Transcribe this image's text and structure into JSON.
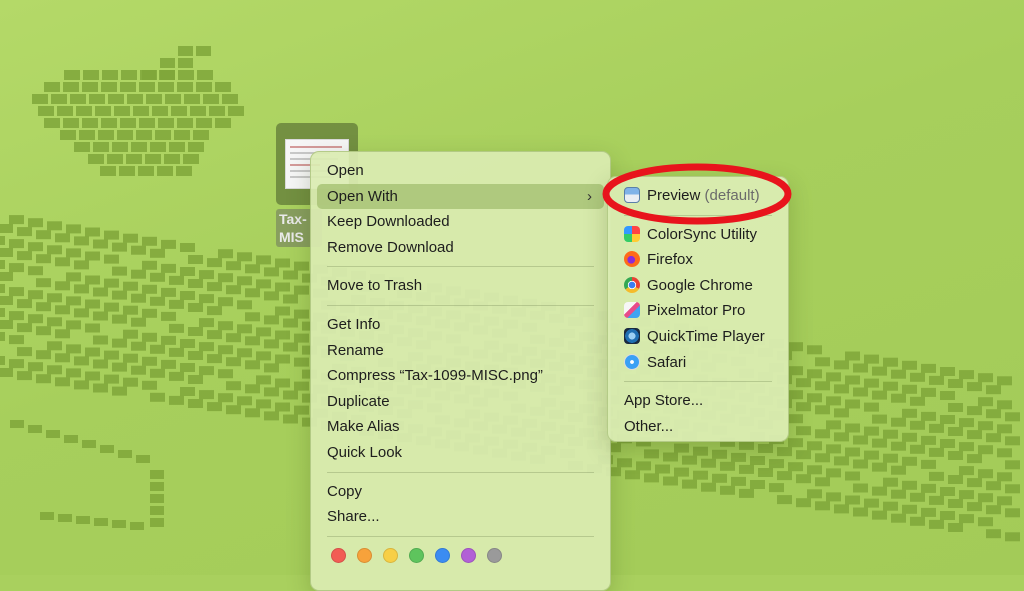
{
  "file": {
    "label_line1": "Tax-",
    "label_line2": "MIS"
  },
  "context_menu": {
    "items": [
      {
        "label": "Open"
      },
      {
        "label": "Open With",
        "has_submenu": true,
        "highlighted": true
      },
      {
        "label": "Keep Downloaded"
      },
      {
        "label": "Remove Download"
      },
      {
        "label": "Move to Trash"
      },
      {
        "label": "Get Info"
      },
      {
        "label": "Rename"
      },
      {
        "label": "Compress “Tax-1099-MISC.png”"
      },
      {
        "label": "Duplicate"
      },
      {
        "label": "Make Alias"
      },
      {
        "label": "Quick Look"
      },
      {
        "label": "Copy"
      },
      {
        "label": "Share..."
      }
    ],
    "chevron_icon": "chevron-right-icon",
    "tag_colors": [
      "#f25c54",
      "#f7a23b",
      "#f7cf46",
      "#5ec45d",
      "#3b8cf2",
      "#b260d6",
      "#9a9a9a"
    ]
  },
  "open_with_submenu": {
    "default_app": {
      "label": "Preview",
      "note": "(default)",
      "icon": "preview-icon"
    },
    "apps": [
      {
        "label": "ColorSync Utility",
        "icon": "colorsync-utility-icon"
      },
      {
        "label": "Firefox",
        "icon": "firefox-icon"
      },
      {
        "label": "Google Chrome",
        "icon": "google-chrome-icon"
      },
      {
        "label": "Pixelmator Pro",
        "icon": "pixelmator-pro-icon"
      },
      {
        "label": "QuickTime Player",
        "icon": "quicktime-player-icon"
      },
      {
        "label": "Safari",
        "icon": "safari-icon"
      }
    ],
    "extra": [
      {
        "label": "App Store..."
      },
      {
        "label": "Other..."
      }
    ]
  },
  "annotation": {
    "color": "#e8141c",
    "shape": "ellipse",
    "target": "Preview (default)"
  }
}
